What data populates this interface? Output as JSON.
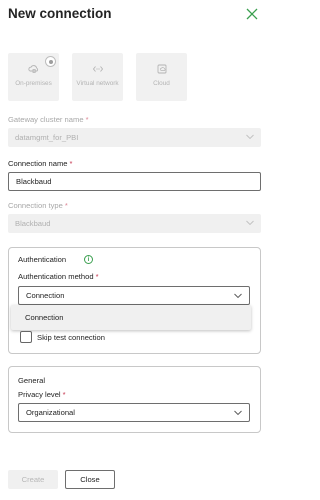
{
  "header": {
    "title": "New connection"
  },
  "connection_types": [
    {
      "label": "On-premises",
      "icon": "cloud-building-icon",
      "selected": true
    },
    {
      "label": "Virtual network",
      "icon": "virtual-network-icon",
      "selected": false
    },
    {
      "label": "Cloud",
      "icon": "cloud-icon",
      "selected": false
    }
  ],
  "gateway": {
    "label": "Gateway cluster name",
    "value": "datamgmt_for_PBI"
  },
  "connection_name": {
    "label": "Connection name",
    "value": "Blackbaud"
  },
  "connection_type": {
    "label": "Connection type",
    "value": "Blackbaud"
  },
  "authentication": {
    "title": "Authentication",
    "method_label": "Authentication method",
    "method_value": "Connection",
    "options": [
      "Connection"
    ],
    "skip_test_label": "Skip test connection"
  },
  "general": {
    "title": "General",
    "privacy_label": "Privacy level",
    "privacy_value": "Organizational"
  },
  "footer": {
    "create_label": "Create",
    "close_label": "Close"
  },
  "required_marker": "*",
  "info_glyph": "i",
  "colors": {
    "accent_green": "#3a9f4f",
    "required_red": "#c4314b",
    "border": "#6e6e6e"
  }
}
